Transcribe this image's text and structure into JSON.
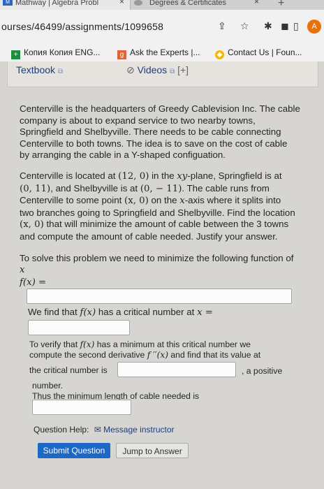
{
  "browser": {
    "tabs": [
      {
        "title": "Mathway | Algebra Probl"
      },
      {
        "title": "Degrees & Certificates"
      }
    ],
    "url": "ourses/46499/assignments/1099658",
    "profile_initial": "A"
  },
  "bookmarks": [
    {
      "label": "Копия Копия ENG..."
    },
    {
      "label": "Ask the Experts |..."
    },
    {
      "label": "Contact Us | Foun..."
    }
  ],
  "links": {
    "textbook": "Textbook",
    "videos": "Videos",
    "more": "[+]"
  },
  "problem": {
    "p1": [
      "Centerville is the headquarters of Greedy Cablevision Inc. The cable",
      "company is about to expand service to two nearby towns,",
      "Springfield and Shelbyville. There needs to be cable connecting",
      "Centerville to both towns. The idea is to save on the cost of cable",
      "by arranging the cable in a Y-shaped configuation."
    ],
    "p2": {
      "l1a": "Centerville is located at ",
      "l1m": "(12, 0)",
      "l1b": " in the ",
      "l1c": "xy",
      "l1d": "-plane, Springfield is at",
      "l2a": "(0, 11)",
      "l2b": ", and Shelbyville is at ",
      "l2c": "(0,  − 11)",
      "l2d": ". The cable runs from",
      "l3a": "Centerville to some point ",
      "l3b": "(x, 0)",
      "l3c": " on the ",
      "l3d": "x",
      "l3e": "-axis where it splits into",
      "l4": "two branches going to Springfield and Shelbyville. Find the location",
      "l5a": "(x, 0)",
      "l5b": " that will minimize the amount of cable between the 3 towns",
      "l6": "and compute the amount of cable needed. Justify your answer."
    },
    "solve_intro": "To solve this problem we need to minimize the following function of",
    "solve_var": "x",
    "fx_label": "f(x) =",
    "critical_a": "We find that ",
    "critical_f": "f(x)",
    "critical_b": " has a critical number at ",
    "critical_x": "x =",
    "verify_a": "To verify that ",
    "verify_f": "f(x)",
    "verify_b": " has a minimum at this critical number we",
    "verify_l2a": "compute the second derivative ",
    "verify_l2f": "f ′′(x)",
    "verify_l2b": " and find that its value at",
    "verify_l3": "the critical number is",
    "verify_l3b": ", a positive",
    "verify_l4": "number.",
    "min_length": "Thus the minimum length of cable needed is"
  },
  "help": {
    "label": "Question Help:",
    "message": "Message instructor"
  },
  "buttons": {
    "submit": "Submit Question",
    "jump": "Jump to Answer"
  }
}
